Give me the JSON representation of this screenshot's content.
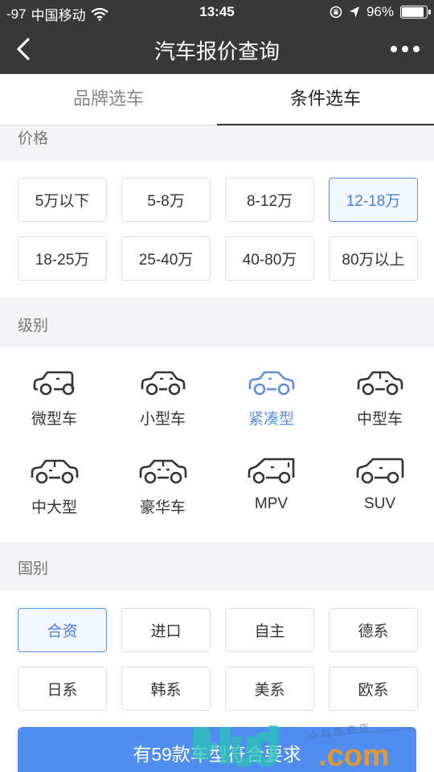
{
  "status_bar": {
    "signal": "-97",
    "carrier": "中国移动",
    "time": "13:45",
    "battery": "96%",
    "battery_level": 0.96
  },
  "nav": {
    "title": "汽车报价查询",
    "back_icon": "chevron-left-icon",
    "more_icon": "more-dots-icon"
  },
  "tabs": [
    {
      "label": "品牌选车",
      "active": false
    },
    {
      "label": "条件选车",
      "active": true
    }
  ],
  "price": {
    "header": "价格",
    "options": [
      {
        "label": "5万以下",
        "selected": false
      },
      {
        "label": "5-8万",
        "selected": false
      },
      {
        "label": "8-12万",
        "selected": false
      },
      {
        "label": "12-18万",
        "selected": true
      },
      {
        "label": "18-25万",
        "selected": false
      },
      {
        "label": "25-40万",
        "selected": false
      },
      {
        "label": "40-80万",
        "selected": false
      },
      {
        "label": "80万以上",
        "selected": false
      }
    ]
  },
  "level": {
    "header": "级别",
    "options": [
      {
        "label": "微型车",
        "icon": "mini-car-icon",
        "selected": false
      },
      {
        "label": "小型车",
        "icon": "small-car-icon",
        "selected": false
      },
      {
        "label": "紧凑型",
        "icon": "compact-car-icon",
        "selected": true
      },
      {
        "label": "中型车",
        "icon": "mid-size-car-icon",
        "selected": false
      },
      {
        "label": "中大型",
        "icon": "large-car-icon",
        "selected": false
      },
      {
        "label": "豪华车",
        "icon": "luxury-car-icon",
        "selected": false
      },
      {
        "label": "MPV",
        "icon": "mpv-icon",
        "selected": false
      },
      {
        "label": "SUV",
        "icon": "suv-icon",
        "selected": false
      }
    ]
  },
  "country": {
    "header": "国别",
    "options": [
      {
        "label": "合资",
        "selected": true
      },
      {
        "label": "进口",
        "selected": false
      },
      {
        "label": "自主",
        "selected": false
      },
      {
        "label": "德系",
        "selected": false
      },
      {
        "label": "日系",
        "selected": false
      },
      {
        "label": "韩系",
        "selected": false
      },
      {
        "label": "美系",
        "selected": false
      },
      {
        "label": "欧系",
        "selected": false
      }
    ]
  },
  "result_button": {
    "label": "有59款车型符合要求"
  },
  "watermark": {
    "text": ".com",
    "subtext": "小 程 序 商 店"
  },
  "colors": {
    "accent": "#5b8fe6",
    "header_bg": "#383838",
    "button": "#4f8ef0"
  }
}
